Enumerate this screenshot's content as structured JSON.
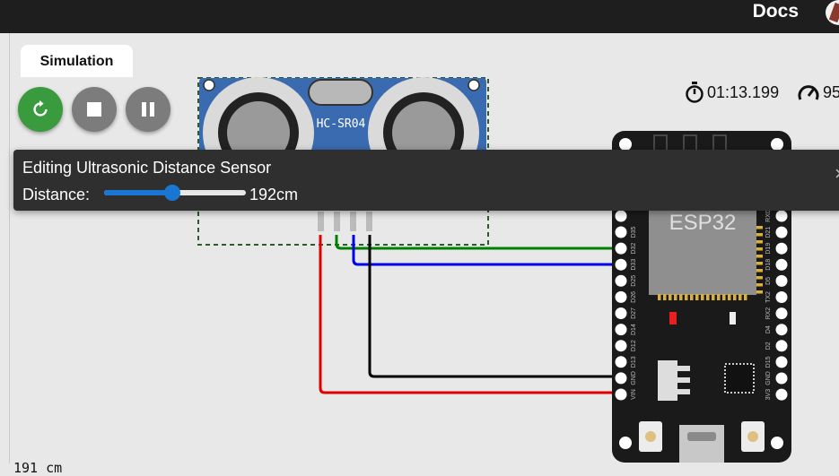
{
  "topbar": {
    "docs_label": "Docs",
    "avatar_icon": "user-avatar-icon"
  },
  "tab": {
    "label": "Simulation"
  },
  "controls": {
    "restart_icon": "restart-icon",
    "stop_icon": "stop-icon",
    "pause_icon": "pause-icon",
    "restart_color": "#3a9a3e",
    "button_color": "#7c7c7c"
  },
  "status": {
    "elapsed": "01:13.199",
    "speed": "95",
    "timer_icon": "stopwatch-icon",
    "speed_icon": "speedometer-icon"
  },
  "sensor": {
    "name": "HC-SR04"
  },
  "board": {
    "name": "ESP32",
    "left_pins": [
      "D35",
      "D32",
      "D33",
      "D25",
      "D26",
      "D27",
      "D14",
      "D12",
      "D13",
      "GND",
      "VIN"
    ],
    "right_pins": [
      "RX0",
      "D21",
      "D19",
      "D18",
      "D5",
      "TX2",
      "RX2",
      "D4",
      "D2",
      "D15",
      "GND",
      "3V3"
    ]
  },
  "popup": {
    "title": "Editing Ultrasonic Distance Sensor",
    "label": "Distance:",
    "value": "192cm",
    "slider_fraction": 0.48
  },
  "wires": {
    "colors": [
      "#e00000",
      "#008000",
      "#0000ee",
      "#000000"
    ]
  },
  "serial_monitor": {
    "line": "191 cm"
  }
}
